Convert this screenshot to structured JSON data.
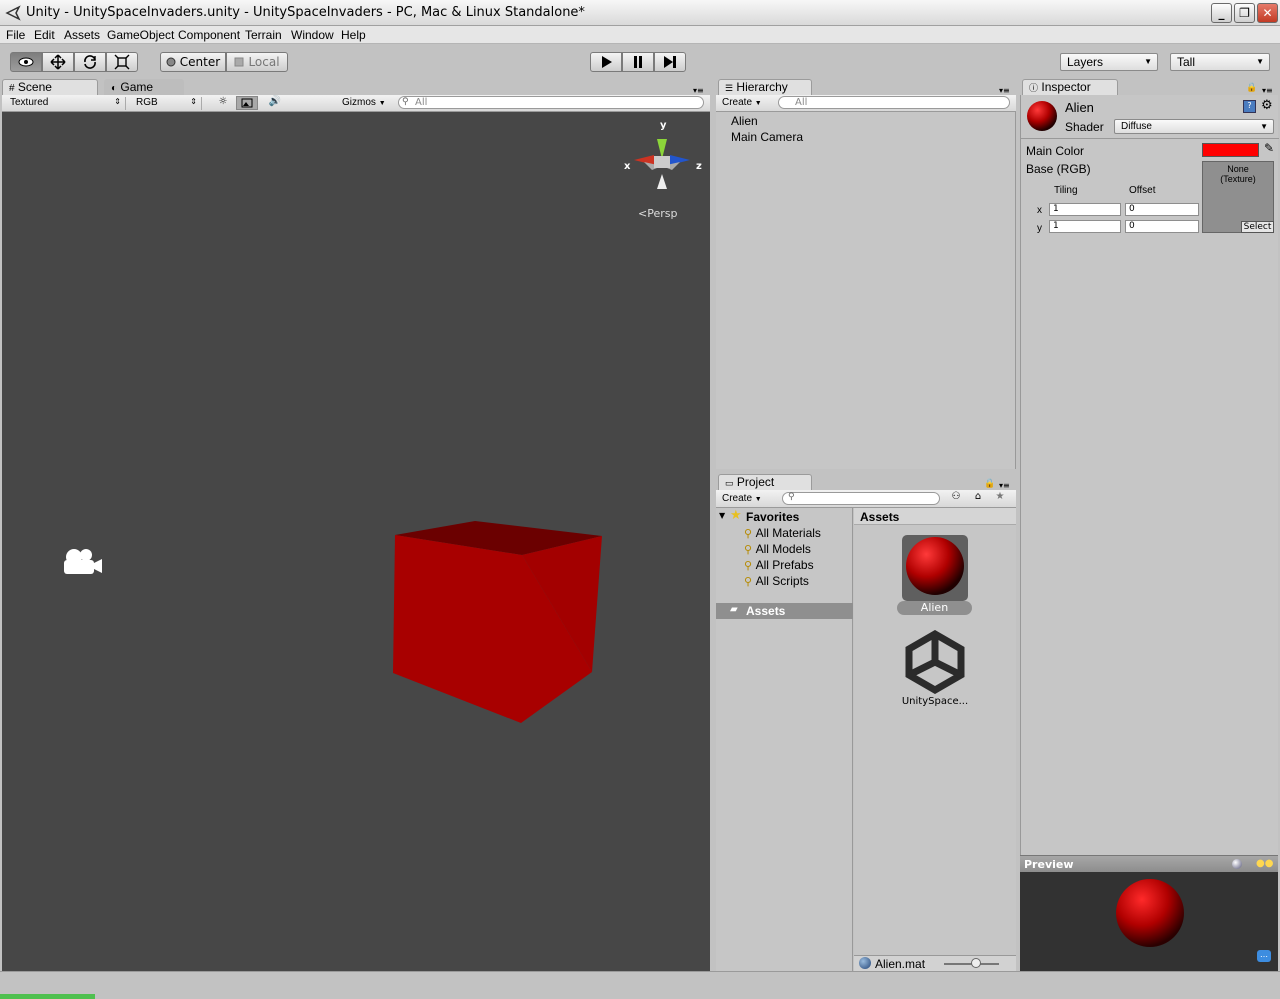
{
  "window": {
    "title": "Unity - UnitySpaceInvaders.unity - UnitySpaceInvaders - PC, Mac & Linux Standalone*"
  },
  "menu": [
    "File",
    "Edit",
    "Assets",
    "GameObject",
    "Component",
    "Terrain",
    "Window",
    "Help"
  ],
  "toolbar": {
    "pivot_center": "Center",
    "pivot_local": "Local",
    "layers": "Layers",
    "layout": "Tall"
  },
  "scene": {
    "tab_scene": "Scene",
    "tab_game": "Game",
    "render_mode": "Textured",
    "channel": "RGB",
    "gizmos": "Gizmos",
    "search_placeholder": "All",
    "axis_x": "x",
    "axis_y": "y",
    "axis_z": "z",
    "persp": "Persp"
  },
  "hierarchy": {
    "tab": "Hierarchy",
    "create": "Create",
    "search_placeholder": "All",
    "items": [
      "Alien",
      "Main Camera"
    ]
  },
  "project": {
    "tab": "Project",
    "create": "Create",
    "favorites": "Favorites",
    "favorite_items": [
      "All Materials",
      "All Models",
      "All Prefabs",
      "All Scripts"
    ],
    "assets_folder": "Assets",
    "assets_header": "Assets",
    "asset_alien": "Alien",
    "asset_scene": "UnitySpace...",
    "status_file": "Alien.mat"
  },
  "inspector": {
    "tab": "Inspector",
    "name": "Alien",
    "shader_label": "Shader",
    "shader_value": "Diffuse",
    "main_color_label": "Main Color",
    "main_color": "#ff0000",
    "base_label": "Base (RGB)",
    "tiling": "Tiling",
    "offset": "Offset",
    "x_label": "x",
    "y_label": "y",
    "tiling_x": "1",
    "tiling_y": "1",
    "offset_x": "0",
    "offset_y": "0",
    "texture_none": "None",
    "texture_type": "(Texture)",
    "texture_select": "Select",
    "preview": "Preview"
  }
}
